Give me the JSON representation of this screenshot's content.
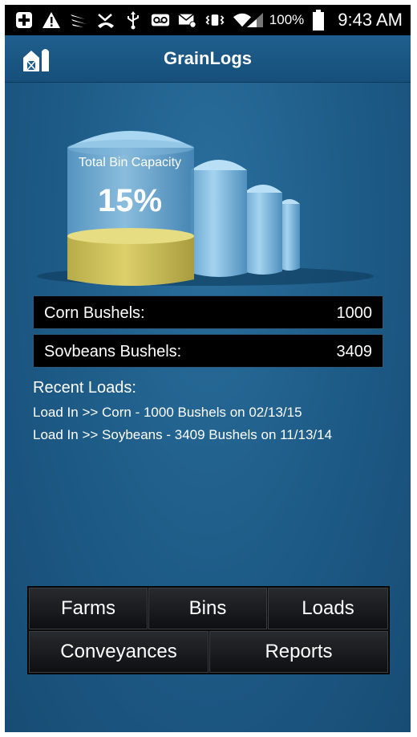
{
  "status_bar": {
    "icons": [
      "add-icon",
      "warning-icon",
      "sprint-icon",
      "missed-call-icon",
      "usb-icon",
      "voicemail-icon",
      "email-icon",
      "vibrate-icon",
      "wifi-icon",
      "signal-icon"
    ],
    "battery_percent": "100%",
    "time": "9:43 AM"
  },
  "header": {
    "title": "GrainLogs",
    "icon": "barn-icon"
  },
  "capacity": {
    "label": "Total Bin Capacity",
    "percent": "15%",
    "fill_fraction": 0.15
  },
  "bushels": [
    {
      "label": "Corn Bushels:",
      "value": "1000"
    },
    {
      "label": "Sovbeans Bushels:",
      "value": "3409"
    }
  ],
  "recent_loads": {
    "title": "Recent Loads:",
    "items": [
      "Load In >> Corn - 1000 Bushels on 02/13/15",
      "Load In >> Soybeans - 3409 Bushels on 11/13/14"
    ]
  },
  "nav": {
    "farms": "Farms",
    "bins": "Bins",
    "loads": "Loads",
    "conveyances": "Conveyances",
    "reports": "Reports"
  },
  "colors": {
    "background": "#1d5a86",
    "grain_fill": "#c9bd58",
    "silo": "#8fc3e6"
  }
}
